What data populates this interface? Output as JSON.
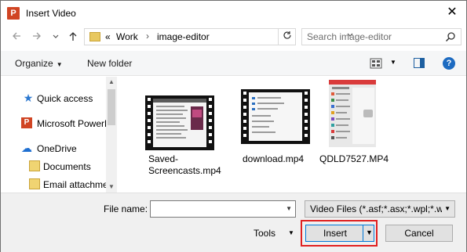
{
  "window": {
    "title": "Insert Video",
    "app_icon_letter": "P",
    "close_symbol": "✕"
  },
  "nav": {
    "back_icon": "back-arrow-icon",
    "forward_icon": "forward-arrow-icon",
    "recent_icon": "chevron-down-icon",
    "up_icon": "up-arrow-icon",
    "breadcrumb_prefix": "«",
    "breadcrumb": [
      "Work",
      "image-editor"
    ],
    "search_placeholder": "Search image-editor"
  },
  "toolbar": {
    "organize_label": "Organize",
    "new_folder_label": "New folder"
  },
  "sidebar": {
    "items": [
      {
        "label": "Quick access",
        "icon": "star-icon"
      },
      {
        "label": "Microsoft PowerPoint",
        "icon": "powerpoint-icon",
        "icon_letter": "P"
      },
      {
        "label": "OneDrive",
        "icon": "cloud-icon"
      },
      {
        "label": "Documents",
        "icon": "folder-icon"
      },
      {
        "label": "Email attachments",
        "icon": "folder-icon"
      }
    ]
  },
  "files": [
    {
      "name_line1": "Saved-",
      "name_line2": "Screencasts.mp4"
    },
    {
      "name_line1": "download.mp4",
      "name_line2": ""
    },
    {
      "name_line1": "QDLD7527.MP4",
      "name_line2": ""
    }
  ],
  "footer": {
    "file_name_label": "File name:",
    "file_name_value": "",
    "filter_label": "Video Files (*.asf;*.asx;*.wpl;*.wm",
    "tools_label": "Tools",
    "insert_label": "Insert",
    "cancel_label": "Cancel"
  },
  "colors": {
    "accent": "#0078d7",
    "highlight": "#e02020",
    "powerpoint": "#d04423"
  }
}
